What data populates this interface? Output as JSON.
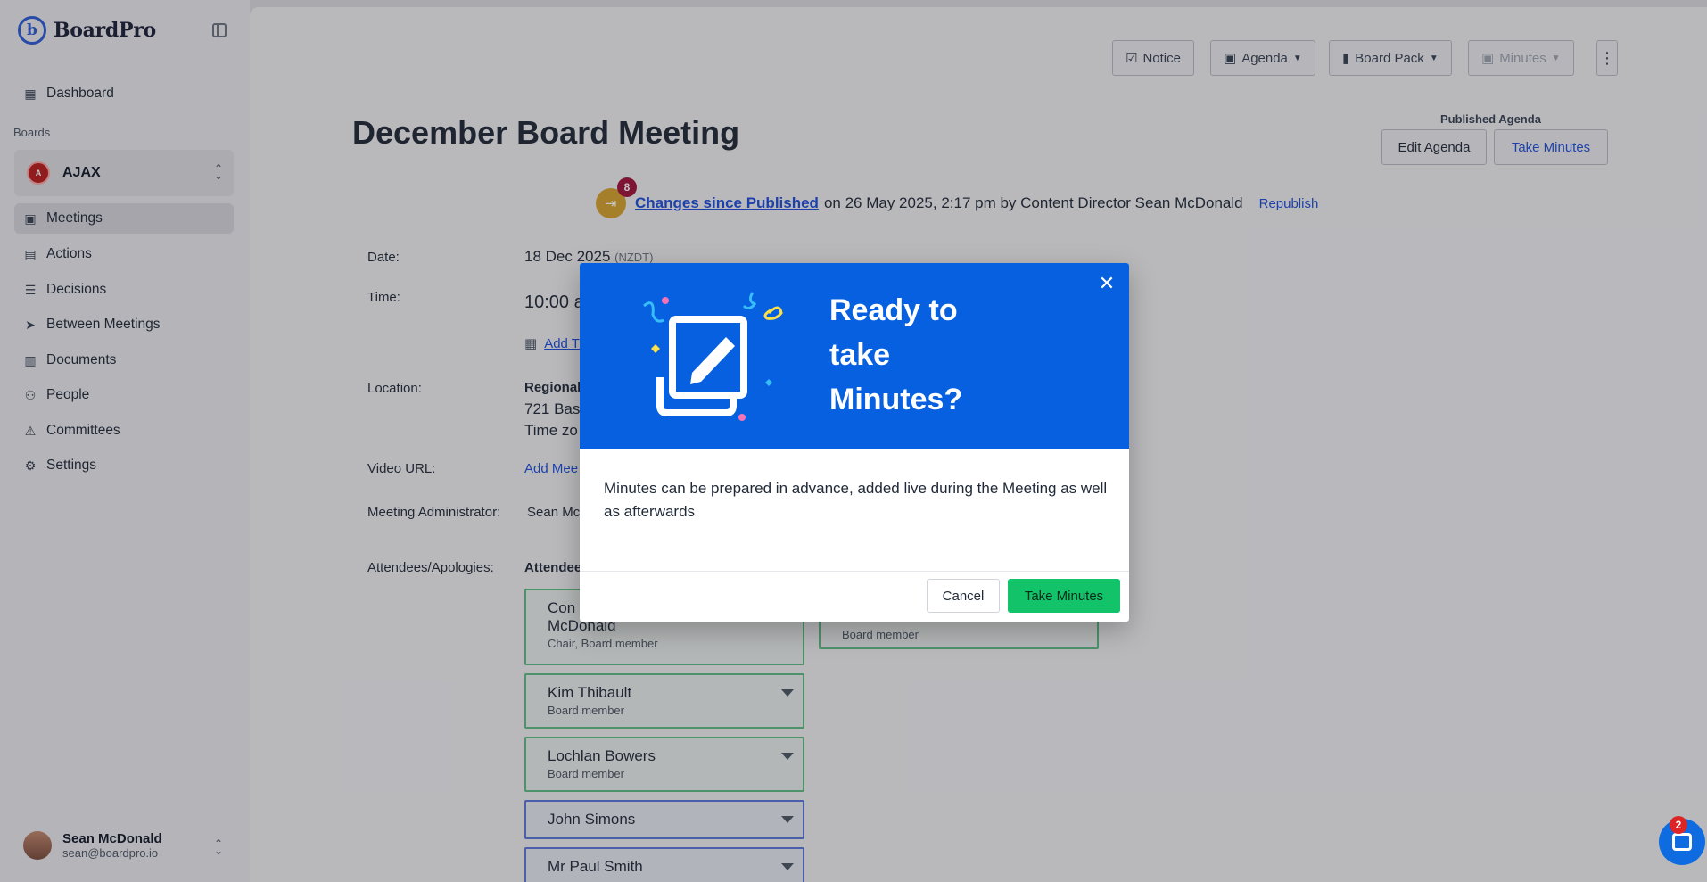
{
  "app": {
    "logo": "BoardPro"
  },
  "sidebar": {
    "items": [
      {
        "label": "Dashboard",
        "icon": "grid-icon"
      },
      {
        "label": "Meetings",
        "icon": "calendar-icon"
      },
      {
        "label": "Actions",
        "icon": "clipboard-icon"
      },
      {
        "label": "Decisions",
        "icon": "checklist-icon"
      },
      {
        "label": "Between Meetings",
        "icon": "paper-plane-icon"
      },
      {
        "label": "Documents",
        "icon": "books-icon"
      },
      {
        "label": "People",
        "icon": "person-icon"
      },
      {
        "label": "Committees",
        "icon": "committee-icon"
      },
      {
        "label": "Settings",
        "icon": "sliders-icon"
      }
    ],
    "boards_label": "Boards",
    "board": {
      "name": "AJAX"
    },
    "user": {
      "name": "Sean McDonald",
      "email": "sean@boardpro.io"
    }
  },
  "toolbar": {
    "notice": "Notice",
    "agenda": "Agenda",
    "board_pack": "Board Pack",
    "minutes": "Minutes",
    "kebab": "⋮"
  },
  "meeting": {
    "title": "December Board Meeting",
    "published_label": "Published Agenda",
    "edit_agenda": "Edit Agenda",
    "take_minutes": "Take Minutes",
    "changes_count": "8",
    "changes_link": "Changes since Published",
    "changes_text": "on 26 May 2025, 2:17 pm by Content Director Sean McDonald",
    "republish": "Republish",
    "date_label": "Date:",
    "date_value": "18 Dec 2025",
    "date_tz": "(NZDT)",
    "time_label": "Time:",
    "time_value": "10:00 a",
    "add_to_cal": "Add T",
    "location_label": "Location:",
    "location_line1": "Regional",
    "location_line2": "721 Bas",
    "location_line3": "Time zo",
    "video_label": "Video URL:",
    "video_link": "Add Mee",
    "admin_label": "Meeting Administrator:",
    "admin_value": "Sean Mc",
    "attendees_label": "Attendees/Apologies:",
    "attendees_header": "Attendee",
    "attendees": [
      {
        "name": "Con",
        "name2": "McDonald",
        "role": "Chair, Board member"
      },
      {
        "name": "Kim Thibault",
        "role": "Board member"
      },
      {
        "name": "Lochlan Bowers",
        "role": "Board member"
      },
      {
        "name": "John Simons",
        "role": ""
      },
      {
        "name": "Mr Paul Smith",
        "role": ""
      }
    ],
    "right_attendee_role": "Board member"
  },
  "modal": {
    "title": "Ready to take Minutes?",
    "body": "Minutes can be prepared in advance, added live during the Meeting as well as afterwards",
    "cancel": "Cancel",
    "confirm": "Take Minutes",
    "close": "✕"
  },
  "chat": {
    "badge": "2"
  },
  "colors": {
    "primary": "#0660e0",
    "success": "#12c36a",
    "link": "#1d4ed8"
  }
}
